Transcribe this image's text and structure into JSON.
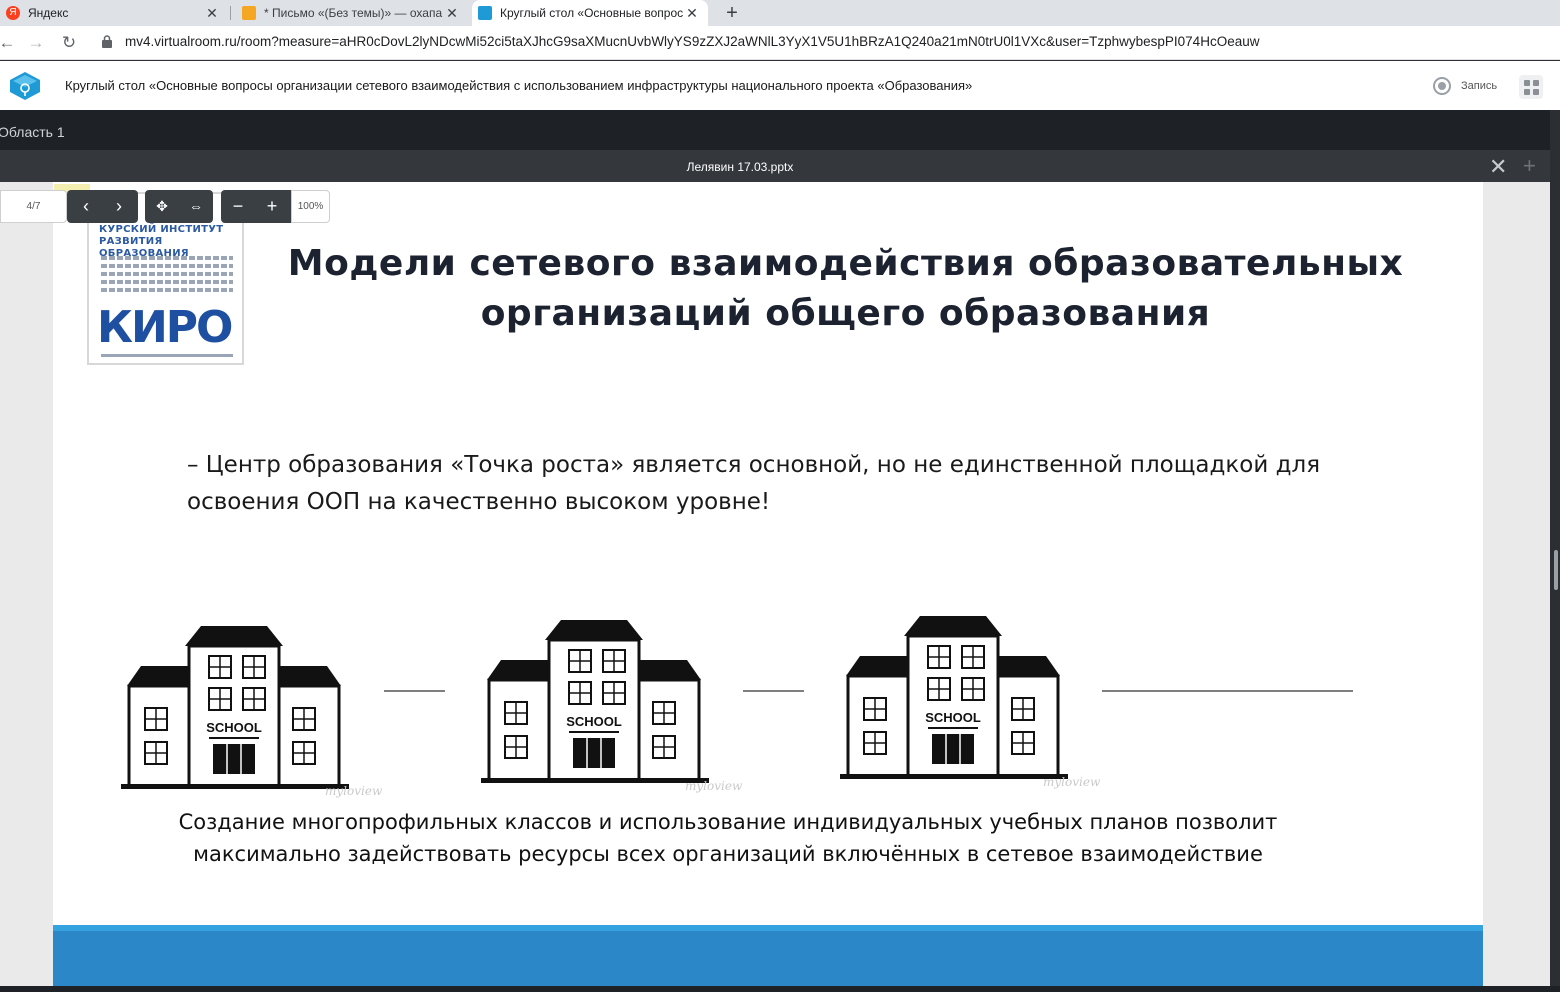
{
  "browser": {
    "tabs": [
      {
        "title": "Яндекс",
        "active": false,
        "favicon": "yandex-icon",
        "color": "#fc3f1d"
      },
      {
        "title": "* Письмо «(Без темы)» — охапа",
        "active": false,
        "favicon": "mail-icon",
        "color": "#f5a623"
      },
      {
        "title": "Круглый стол «Основные вопрос",
        "active": true,
        "favicon": "virtualroom-icon",
        "color": "#1e9ad6"
      }
    ],
    "url": "mv4.virtualroom.ru/room?measure=aHR0cDovL2lyNDcwMi52ci5taXJhcG9saXMucnUvbWlyYS9zZXJ2aWNlL3YyX1V5U1hBRzA1Q240a21mN0trU0l1VXc&user=TzphwybespPI074HcOeauw"
  },
  "app": {
    "title": "Круглый стол «Основные вопросы организации сетевого взаимодействия с использованием инфраструктуры национального проекта «Образования»",
    "record_label": "Запись",
    "accent": "#1e9ad6"
  },
  "area": {
    "label": "Область 1",
    "filename": "Лелявин 17.03.pptx"
  },
  "viewer": {
    "page": "4/7",
    "zoom": "100%"
  },
  "slide": {
    "logo_text_line1": "КУРСКИЙ ИНСТИТУТ",
    "logo_text_line2": "РАЗВИТИЯ ОБРАЗОВАНИЯ",
    "logo_word": "КИРО",
    "title_line1": "Модели сетевого взаимодействия образовательных",
    "title_line2": "организаций общего образования",
    "body": "– Центр образования «Точка роста» является основной, но не единственной площадкой для освоения ООП на качественно высоком уровне!",
    "school_label": "SCHOOL",
    "watermark": "myloview",
    "caption_line1": "Создание многопрофильных классов и использование индивидуальных учебных планов позволит",
    "caption_line2": "максимально задействовать ресурсы всех организаций включённых в сетевое взаимодействие",
    "band_color": "#2b87c8"
  }
}
